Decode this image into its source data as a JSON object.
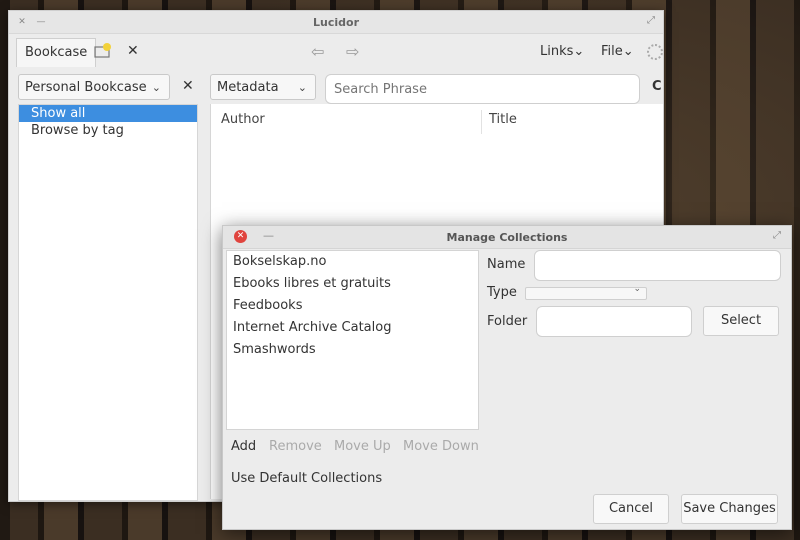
{
  "app": {
    "title": "Lucidor",
    "tab_label": "Bookcase",
    "menus": {
      "links": "Links",
      "file": "File"
    },
    "bookcase_select": "Personal Bookcase",
    "field_select": "Metadata",
    "search_placeholder": "Search Phrase",
    "clipped_button_text": "C",
    "sidebar_items": [
      "Show all",
      "Browse by tag"
    ],
    "columns": [
      "Author",
      "Title"
    ]
  },
  "dialog": {
    "title": "Manage Collections",
    "collections": [
      "Bokselskap.no",
      "Ebooks libres et gratuits",
      "Feedbooks",
      "Internet Archive Catalog",
      "Smashwords"
    ],
    "labels": {
      "name": "Name",
      "type": "Type",
      "folder": "Folder"
    },
    "select_button": "Select",
    "actions": {
      "add": "Add",
      "remove": "Remove",
      "move_up": "Move Up",
      "move_down": "Move Down"
    },
    "use_default": "Use Default Collections",
    "cancel": "Cancel",
    "save": "Save Changes"
  },
  "colors": {
    "selection": "#3d8ee0",
    "close_button": "#e0443e"
  }
}
